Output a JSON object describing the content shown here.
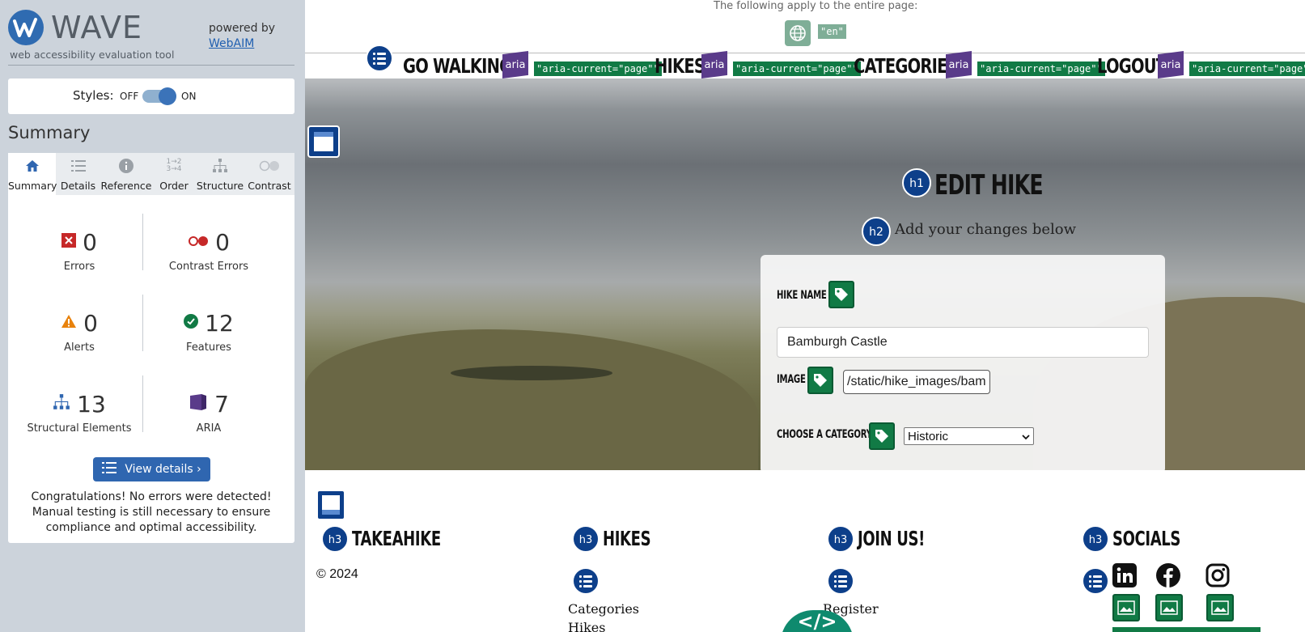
{
  "wave": {
    "logo_text": "WAVE",
    "tagline": "web accessibility evaluation tool",
    "powered_by": "powered by",
    "webaim_link": "WebAIM",
    "styles_label": "Styles:",
    "styles_off": "OFF",
    "styles_on": "ON",
    "styles_state": "on",
    "summary_heading": "Summary",
    "tabs": [
      {
        "label": "Summary",
        "icon": "home-icon",
        "active": true
      },
      {
        "label": "Details",
        "icon": "list-icon",
        "active": false
      },
      {
        "label": "Reference",
        "icon": "info-icon",
        "active": false
      },
      {
        "label": "Order",
        "icon": "order-icon",
        "active": false
      },
      {
        "label": "Structure",
        "icon": "structure-icon",
        "active": false
      },
      {
        "label": "Contrast",
        "icon": "contrast-icon",
        "active": false
      }
    ],
    "stats": {
      "errors": {
        "count": "0",
        "label": "Errors"
      },
      "contrast_errors": {
        "count": "0",
        "label": "Contrast Errors"
      },
      "alerts": {
        "count": "0",
        "label": "Alerts"
      },
      "features": {
        "count": "12",
        "label": "Features"
      },
      "structural": {
        "count": "13",
        "label": "Structural Elements"
      },
      "aria": {
        "count": "7",
        "label": "ARIA"
      }
    },
    "view_details_button": "View details ›",
    "congrats_message": "Congratulations! No errors were detected! Manual testing is still necessary to ensure compliance and optimal accessibility."
  },
  "page": {
    "page_note": "The following apply to the entire page:",
    "lang_tag": "\"en\"",
    "nav": [
      {
        "label": "GO WALKING!",
        "aria_tag": "\"aria-current=\"page\"\""
      },
      {
        "label": "HIKES",
        "aria_tag": "\"aria-current=\"page\"\""
      },
      {
        "label": "CATEGORIES",
        "aria_tag": "\"aria-current=\"page\"\""
      },
      {
        "label": "LOGOUT",
        "aria_tag": "\"aria-current=\"page\"\""
      }
    ],
    "aria_badge": "aria",
    "h1_badge": "h1",
    "title": "EDIT HIKE",
    "h2_badge": "h2",
    "subtitle": "Add your changes below",
    "form": {
      "hike_name_label": "HIKE NAME",
      "hike_name_value": "Bamburgh Castle",
      "image_label": "IMAGE",
      "image_value": "/static/hike_images/bam",
      "category_label": "CHOOSE A CATEGORY",
      "category_value": "Historic"
    },
    "footer": {
      "h3_badge": "h3",
      "columns": [
        {
          "heading": "TAKEAHIKE"
        },
        {
          "heading": "HIKES",
          "links": [
            "Categories",
            "Hikes"
          ]
        },
        {
          "heading": "JOIN US!",
          "links": [
            "Register"
          ]
        },
        {
          "heading": "SOCIALS"
        }
      ],
      "copyright": "© 2024",
      "socials": [
        "linkedin-icon",
        "facebook-icon",
        "instagram-icon"
      ],
      "code_icon": "</>"
    }
  },
  "colors": {
    "wave_blue": "#2f66b0",
    "aria_purple": "#5a3b8a",
    "feature_green": "#117a45",
    "error_red": "#c62828",
    "alert_orange": "#e8820c"
  }
}
